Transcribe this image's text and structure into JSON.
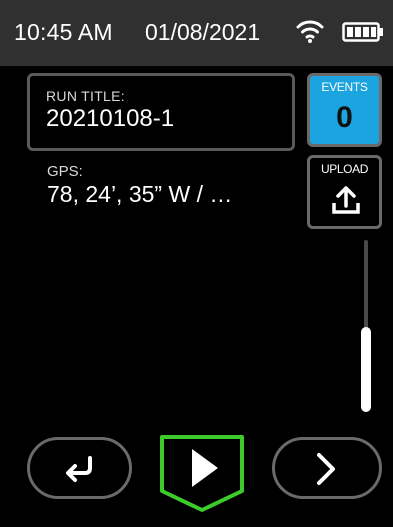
{
  "status_bar": {
    "time": "10:45 AM",
    "date": "01/08/2021",
    "wifi_icon": "wifi-icon",
    "battery_icon": "battery-full-icon",
    "background": "#303030"
  },
  "run_title": {
    "label": "RUN TITLE:",
    "value": "20210108-1"
  },
  "gps": {
    "label": "GPS:",
    "value": "78, 24’, 35” W / …"
  },
  "events": {
    "label": "EVENTS",
    "count": "0",
    "color": "#1ba4e0"
  },
  "upload": {
    "label": "UPLOAD",
    "icon": "upload-icon"
  },
  "scroll": {
    "position_fraction": 1.0
  },
  "controls": {
    "back_icon": "return-arrow-icon",
    "play_icon": "play-icon",
    "next_icon": "chevron-right-icon",
    "play_accent": "#3ccb2a"
  }
}
